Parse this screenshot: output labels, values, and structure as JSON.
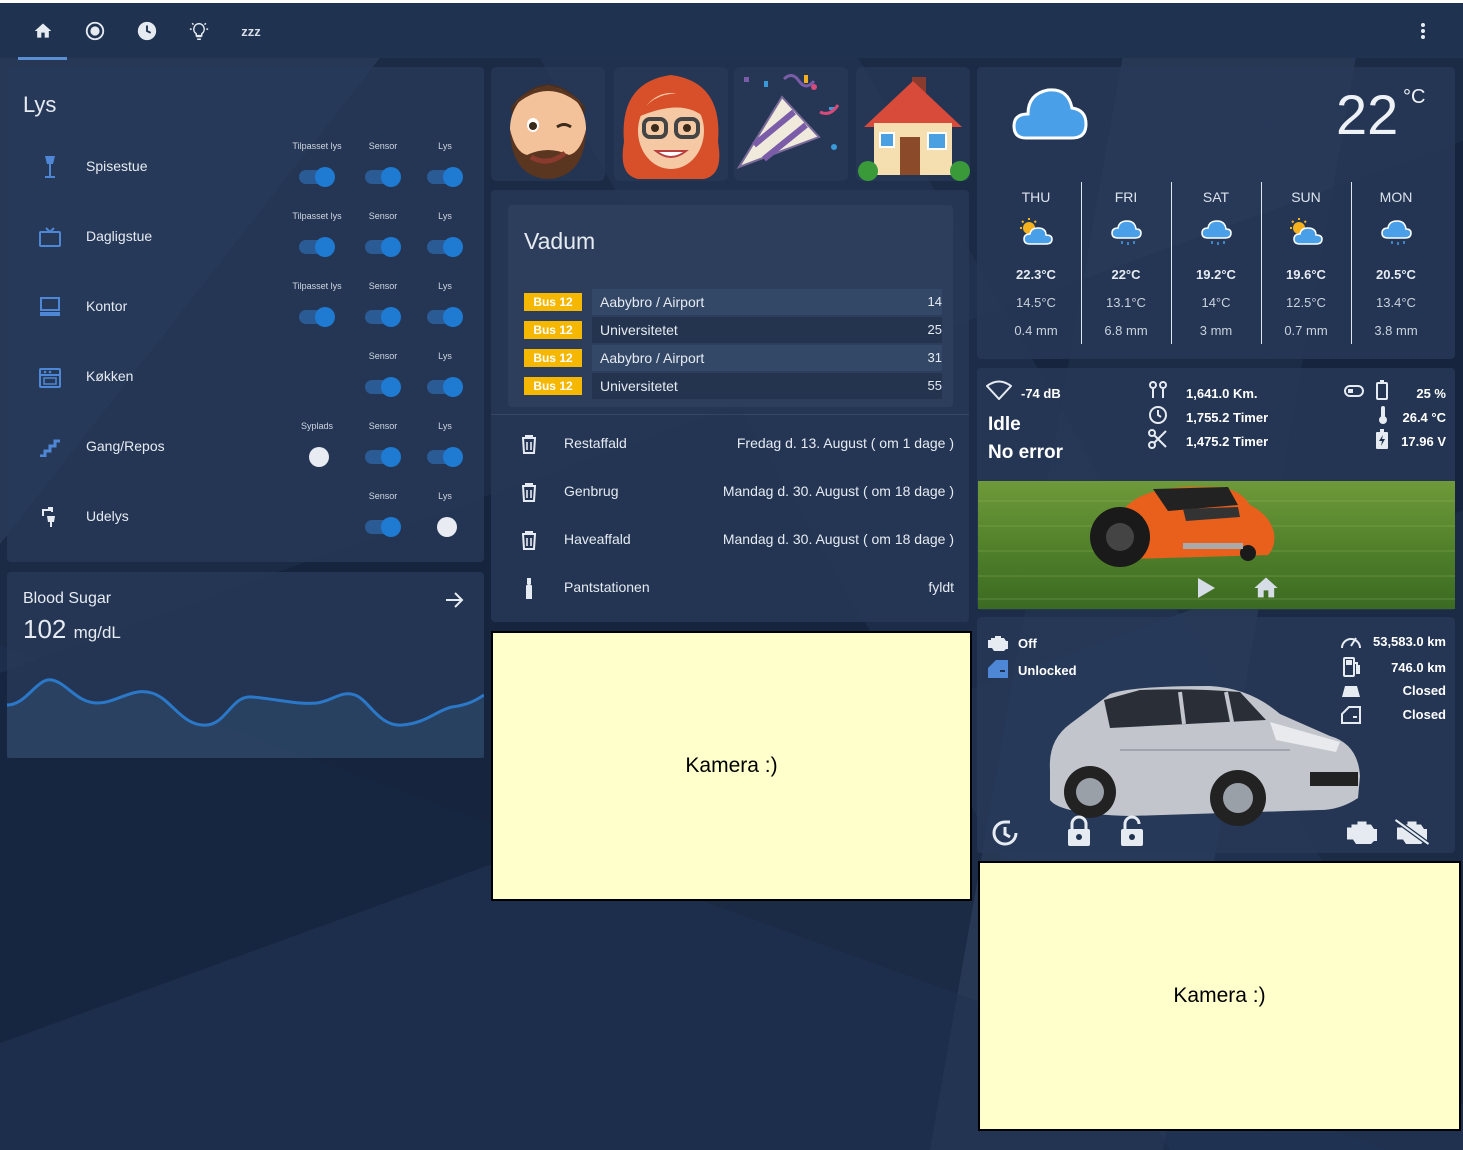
{
  "nav": {
    "tabs": [
      {
        "icon": "home-icon",
        "active": true
      },
      {
        "icon": "robot-mower-icon"
      },
      {
        "icon": "clock-icon"
      },
      {
        "icon": "lightbulb-icon"
      },
      {
        "icon": "sleep-icon",
        "label": "zzz"
      }
    ],
    "menu_icon": "dots-vertical-icon"
  },
  "lights": {
    "title": "Lys",
    "rows": [
      {
        "name": "Spisestue",
        "icon": "floor-lamp-icon",
        "toggles": [
          {
            "label": "Tilpasset lys",
            "on": true
          },
          {
            "label": "Sensor",
            "on": true
          },
          {
            "label": "Lys",
            "on": true
          }
        ]
      },
      {
        "name": "Dagligstue",
        "icon": "tv-icon",
        "toggles": [
          {
            "label": "Tilpasset lys",
            "on": true
          },
          {
            "label": "Sensor",
            "on": true
          },
          {
            "label": "Lys",
            "on": true
          }
        ]
      },
      {
        "name": "Kontor",
        "icon": "desktop-icon",
        "toggles": [
          {
            "label": "Tilpasset lys",
            "on": true
          },
          {
            "label": "Sensor",
            "on": true
          },
          {
            "label": "Lys",
            "on": true
          }
        ]
      },
      {
        "name": "Køkken",
        "icon": "stove-icon",
        "toggles": [
          {
            "label": "Sensor",
            "on": true
          },
          {
            "label": "Lys",
            "on": true
          }
        ]
      },
      {
        "name": "Gang/Repos",
        "icon": "stairs-icon",
        "toggles": [
          {
            "label": "Syplads",
            "on": false
          },
          {
            "label": "Sensor",
            "on": true
          },
          {
            "label": "Lys",
            "on": true
          }
        ]
      },
      {
        "name": "Udelys",
        "icon": "outdoor-lamp-icon",
        "toggles": [
          {
            "label": "Sensor",
            "on": true
          },
          {
            "label": "Lys",
            "on": false
          }
        ]
      }
    ]
  },
  "blood_sugar": {
    "title": "Blood Sugar",
    "value": "102",
    "unit": "mg/dL"
  },
  "avatars": [
    "winking-man-memoji",
    "red-hair-woman-memoji",
    "party-popper-emoji",
    "house-emoji"
  ],
  "transit": {
    "title": "Vadum",
    "departures": [
      {
        "line": "Bus 12",
        "destination": "Aabybro / Airport",
        "minutes": "14"
      },
      {
        "line": "Bus 12",
        "destination": "Universitetet",
        "minutes": "25"
      },
      {
        "line": "Bus 12",
        "destination": "Aabybro / Airport",
        "minutes": "31"
      },
      {
        "line": "Bus 12",
        "destination": "Universitetet",
        "minutes": "55"
      }
    ]
  },
  "waste": [
    {
      "name": "Restaffald",
      "date": "Fredag d. 13. August ( om 1 dage )",
      "icon": "trash-icon"
    },
    {
      "name": "Genbrug",
      "date": "Mandag d. 30. August ( om 18 dage )",
      "icon": "trash-icon"
    },
    {
      "name": "Haveaffald",
      "date": "Mandag d. 30. August ( om 18 dage )",
      "icon": "trash-icon"
    },
    {
      "name": "Pantstationen",
      "date": "fyldt",
      "icon": "bottle-icon"
    }
  ],
  "camera1": {
    "label": "Kamera :)"
  },
  "camera2": {
    "label": "Kamera :)"
  },
  "weather": {
    "current_temp": "22",
    "unit": "°C",
    "current_icon": "cloudy-icon",
    "forecast": [
      {
        "day": "THU",
        "icon": "partly-cloudy-icon",
        "high": "22.3°C",
        "low": "14.5°C",
        "precip": "0.4 mm"
      },
      {
        "day": "FRI",
        "icon": "rainy-icon",
        "high": "22°C",
        "low": "13.1°C",
        "precip": "6.8 mm"
      },
      {
        "day": "SAT",
        "icon": "rainy-icon",
        "high": "19.2°C",
        "low": "14°C",
        "precip": "3 mm"
      },
      {
        "day": "SUN",
        "icon": "partly-cloudy-icon",
        "high": "19.6°C",
        "low": "12.5°C",
        "precip": "0.7 mm"
      },
      {
        "day": "MON",
        "icon": "rainy-icon",
        "high": "20.5°C",
        "low": "13.4°C",
        "precip": "3.8 mm"
      }
    ]
  },
  "mower": {
    "wifi": "-74 dB",
    "state": "Idle",
    "error": "No error",
    "distance": "1,641.0 Km.",
    "time_total": "1,755.2 Timer",
    "blade_time": "1,475.2 Timer",
    "battery": "25 %",
    "temp": "26.4 °C",
    "voltage": "17.96 V"
  },
  "car": {
    "engine": "Off",
    "lock": "Unlocked",
    "odometer": "53,583.0 km",
    "range": "746.0 km",
    "hood": "Closed",
    "doors": "Closed"
  }
}
